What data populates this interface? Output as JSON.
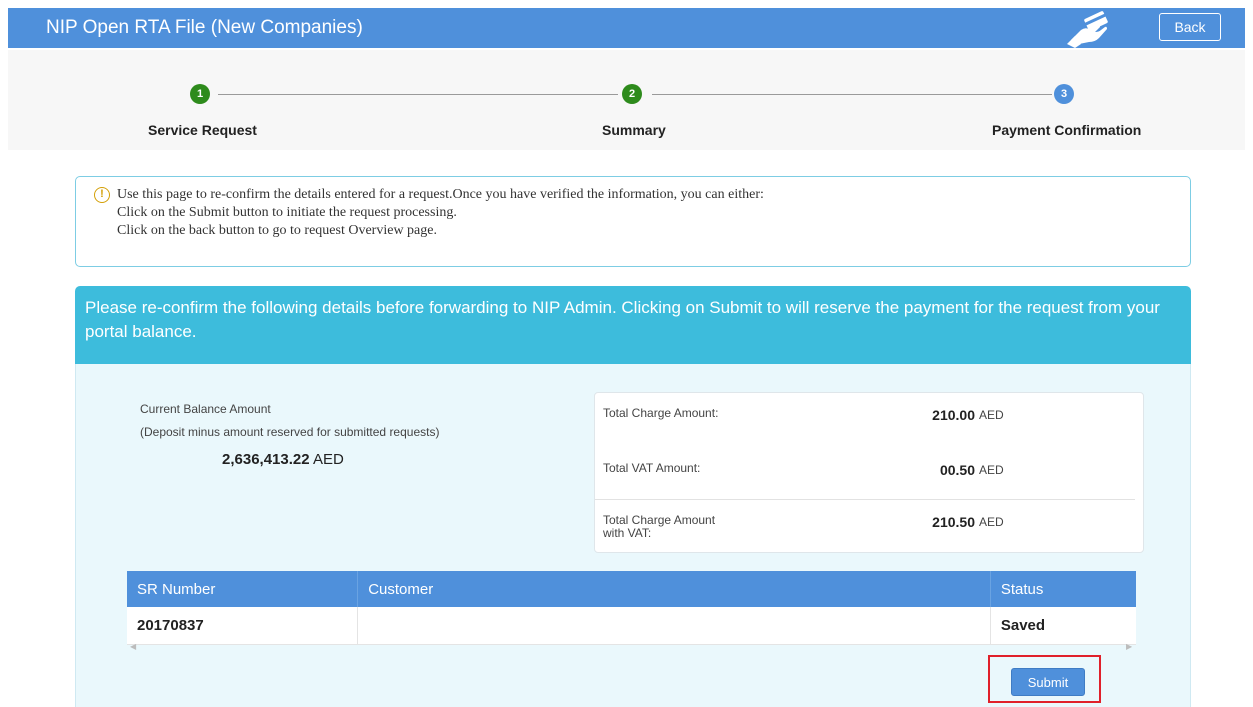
{
  "header": {
    "title": "NIP Open RTA File (New Companies)",
    "payment_icon": "hand-card-icon",
    "back_label": "Back"
  },
  "stepper": {
    "steps": [
      {
        "number": "1",
        "label": "Service Request",
        "status": "complete",
        "color": "#2e8b1c"
      },
      {
        "number": "2",
        "label": "Summary",
        "status": "complete",
        "color": "#2e8b1c"
      },
      {
        "number": "3",
        "label": "Payment Confirmation",
        "status": "current",
        "color": "#4f90db"
      }
    ]
  },
  "info": {
    "icon": "info-icon",
    "icon_glyph": "!",
    "lines": [
      "Use this page to re-confirm the details entered for a request.Once you have verified the information, you can either:",
      "Click on the Submit button to initiate the request processing.",
      "Click on the back button to go to request Overview page."
    ]
  },
  "banner": {
    "text": "Please re-confirm the following details before forwarding to NIP Admin. Clicking on Submit to will reserve the payment for the request from your portal balance."
  },
  "balance": {
    "label": "Current Balance Amount",
    "sublabel": "(Deposit minus amount reserved for submitted requests)",
    "amount": "2,636,413.22",
    "currency": "AED"
  },
  "summary": {
    "rows": [
      {
        "label_lines": [
          "Total Charge Amount:"
        ],
        "value": "210.00",
        "currency": "AED"
      },
      {
        "label_lines": [
          "Total VAT Amount:"
        ],
        "value": "00.50",
        "currency": "AED"
      },
      {
        "label_lines": [
          "Total Charge Amount",
          "with VAT:"
        ],
        "value": "210.50",
        "currency": "AED"
      }
    ]
  },
  "table": {
    "headers": [
      "SR Number",
      "Customer",
      "Status"
    ],
    "rows": [
      {
        "sr_number": "20170837",
        "customer": "",
        "status": "Saved"
      }
    ]
  },
  "submit_label": "Submit",
  "colors": {
    "header": "#4f90db",
    "banner": "#3dbcdc",
    "panel": "#eaf8fc",
    "highlight": "#e0202a"
  }
}
